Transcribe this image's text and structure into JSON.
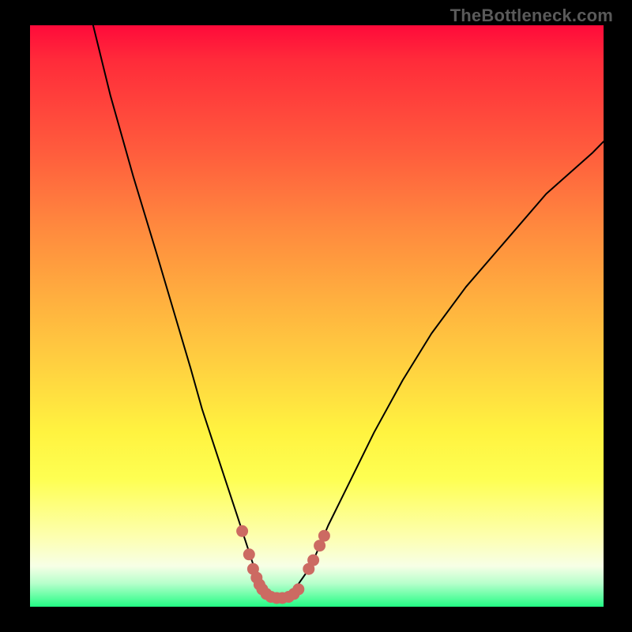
{
  "watermark": "TheBottleneck.com",
  "chart_data": {
    "type": "line",
    "title": "",
    "xlabel": "",
    "ylabel": "",
    "xlim": [
      0,
      100
    ],
    "ylim": [
      0,
      100
    ],
    "series": [
      {
        "name": "curve",
        "x": [
          11,
          14,
          18,
          22,
          25,
          28,
          30,
          32,
          34,
          36,
          38,
          39,
          40,
          41,
          42,
          43,
          44,
          46,
          49,
          52,
          56,
          60,
          65,
          70,
          76,
          83,
          90,
          98,
          100
        ],
        "y": [
          100,
          88,
          74,
          61,
          51,
          41,
          34,
          28,
          22,
          16,
          10,
          7,
          4.5,
          2.8,
          1.8,
          1.4,
          1.6,
          2.8,
          7,
          14,
          22,
          30,
          39,
          47,
          55,
          63,
          71,
          78,
          80
        ]
      },
      {
        "name": "markers-left",
        "x": [
          37.0,
          38.2,
          38.9,
          39.5,
          40.0,
          40.5,
          41.2,
          42.0,
          43.0,
          44.0,
          45.1,
          46.0,
          46.8
        ],
        "y": [
          13.0,
          9.0,
          6.5,
          5.0,
          3.8,
          3.0,
          2.2,
          1.7,
          1.5,
          1.5,
          1.7,
          2.2,
          3.0
        ]
      },
      {
        "name": "markers-right",
        "x": [
          48.6,
          49.4,
          50.5,
          51.3
        ],
        "y": [
          6.5,
          8.0,
          10.5,
          12.2
        ]
      }
    ],
    "gradient_stops": [
      {
        "pos": 0.0,
        "color": "#ff0a3a"
      },
      {
        "pos": 0.35,
        "color": "#ff8a3e"
      },
      {
        "pos": 0.7,
        "color": "#fff340"
      },
      {
        "pos": 0.93,
        "color": "#f7ffe6"
      },
      {
        "pos": 1.0,
        "color": "#23fc84"
      }
    ]
  }
}
